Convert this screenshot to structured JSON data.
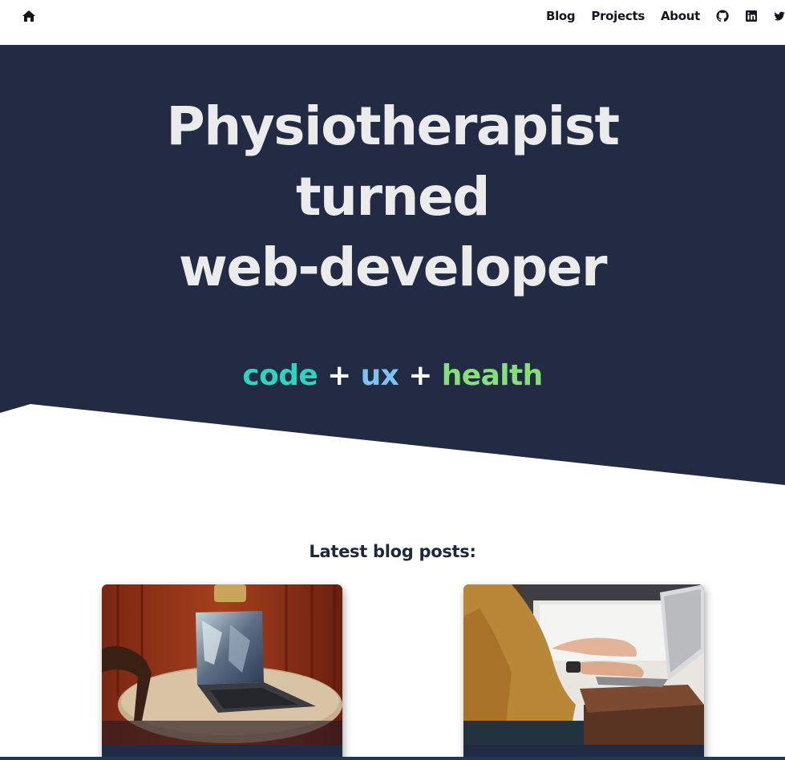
{
  "nav": {
    "home_icon": "home-icon",
    "links": [
      "Blog",
      "Projects",
      "About"
    ],
    "social_icons": [
      "github-icon",
      "linkedin-icon",
      "twitter-icon"
    ]
  },
  "hero": {
    "title_lines": [
      "Physiotherapist",
      "turned",
      "web-developer"
    ],
    "tagline": {
      "code": "code",
      "plus1": "+",
      "ux": "ux",
      "plus2": "+",
      "health": "health"
    },
    "colors": {
      "background": "#222b43",
      "title": "#ebebeb",
      "code": "#2dd4bf",
      "ux": "#7cc2f2",
      "health": "#86e07a"
    }
  },
  "blog": {
    "heading": "Latest blog posts:",
    "cards": [
      {
        "image": "laptop-on-round-table-photo"
      },
      {
        "image": "person-typing-on-laptop-photo"
      }
    ]
  }
}
